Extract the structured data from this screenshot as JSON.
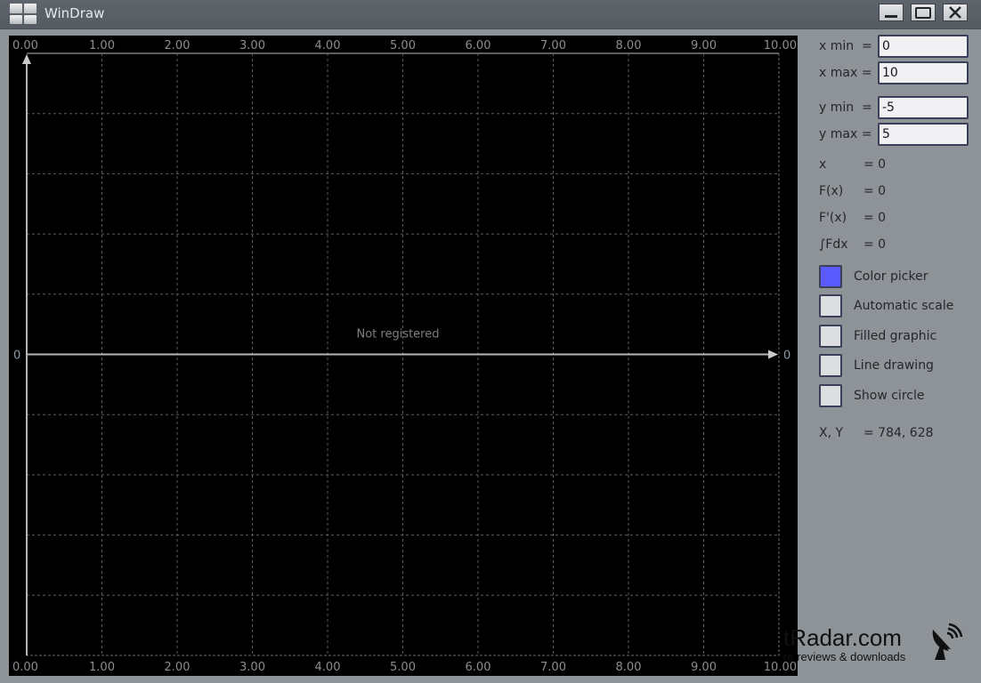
{
  "window": {
    "title": "WinDraw",
    "controls": {
      "minimize": "minimize",
      "maximize": "maximize",
      "close": "close"
    }
  },
  "plot": {
    "x_ticks": [
      "0.00",
      "1.00",
      "2.00",
      "3.00",
      "4.00",
      "5.00",
      "6.00",
      "7.00",
      "8.00",
      "9.00",
      "10.00"
    ],
    "y_zero_left": "0",
    "y_zero_right": "0",
    "watermark": "Not registered",
    "xlim": [
      0,
      10
    ],
    "ylim": [
      -5,
      5
    ],
    "grid": true,
    "colors": {
      "background": "#000000",
      "axis": "#b4b6b8",
      "grid": "#5a5c5e"
    }
  },
  "panel": {
    "fields": [
      {
        "label": "x min  =",
        "value": "0"
      },
      {
        "label": "x max =",
        "value": "10"
      },
      {
        "label": "y min  =",
        "value": "-5"
      },
      {
        "label": "y max =",
        "value": "5"
      }
    ],
    "readouts": [
      {
        "label": "x",
        "value": "= 0"
      },
      {
        "label": "F(x)",
        "value": "= 0"
      },
      {
        "label": "F'(x)",
        "value": "= 0"
      },
      {
        "label": "∫Fdx",
        "value": "= 0"
      }
    ],
    "options": [
      {
        "label": "Color picker",
        "color": "#5b5bff"
      },
      {
        "label": "Automatic scale",
        "checked": false
      },
      {
        "label": "Filled graphic",
        "checked": false
      },
      {
        "label": "Line drawing",
        "checked": false
      },
      {
        "label": "Show circle",
        "checked": false
      }
    ],
    "cursor": {
      "label": "X, Y",
      "value": "= 784, 628"
    }
  },
  "watermark_brand": {
    "main": "SoftRadar.com",
    "visible_main": "tRadar.com",
    "sub": "re reviews & downloads"
  }
}
